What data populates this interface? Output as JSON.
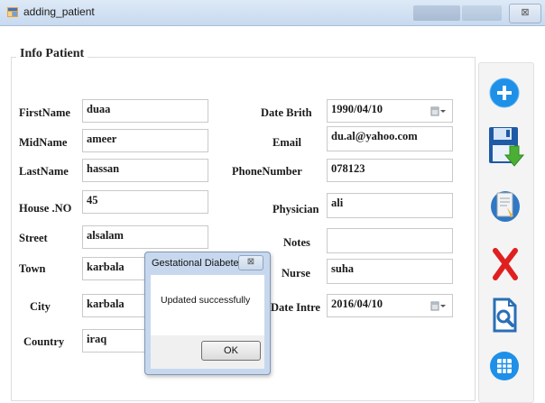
{
  "window": {
    "title": "adding_patient",
    "close_glyph": "⊠",
    "icon": "form-app-icon"
  },
  "group": {
    "title": "Info Patient"
  },
  "fields_left": [
    {
      "label": "FirstName",
      "value": "duaa"
    },
    {
      "label": "MidName",
      "value": "ameer"
    },
    {
      "label": "LastName",
      "value": "hassan"
    },
    {
      "label": "House .NO",
      "value": "45"
    },
    {
      "label": "Street",
      "value": "alsalam"
    },
    {
      "label": "Town",
      "value": "karbala"
    },
    {
      "label": "City",
      "value": "karbala"
    },
    {
      "label": "Country",
      "value": "iraq"
    }
  ],
  "fields_right": [
    {
      "label": "Date Brith",
      "value": "1990/04/10"
    },
    {
      "label": "Email",
      "value": "du.al@yahoo.com"
    },
    {
      "label": "PhoneNumber",
      "value": "078123"
    },
    {
      "label": "Physician",
      "value": "ali"
    },
    {
      "label": "Notes",
      "value": ""
    },
    {
      "label": "Nurse",
      "value": "suha"
    },
    {
      "label": "Date Intre",
      "value": "2016/04/10"
    }
  ],
  "toolbar": {
    "icons": [
      "add-icon",
      "save-icon",
      "notes-icon",
      "delete-icon",
      "search-document-icon",
      "grid-icon"
    ],
    "colors": {
      "add": "#1e90e8",
      "save_blue": "#1f5aa6",
      "save_green": "#4caf35",
      "delete": "#e02020",
      "search": "#2a6fb6",
      "grid": "#1e90e8"
    }
  },
  "dialog": {
    "title": "Gestational Diabetes",
    "close_glyph": "⊠",
    "message": "Updated successfully",
    "ok_label": "OK"
  }
}
